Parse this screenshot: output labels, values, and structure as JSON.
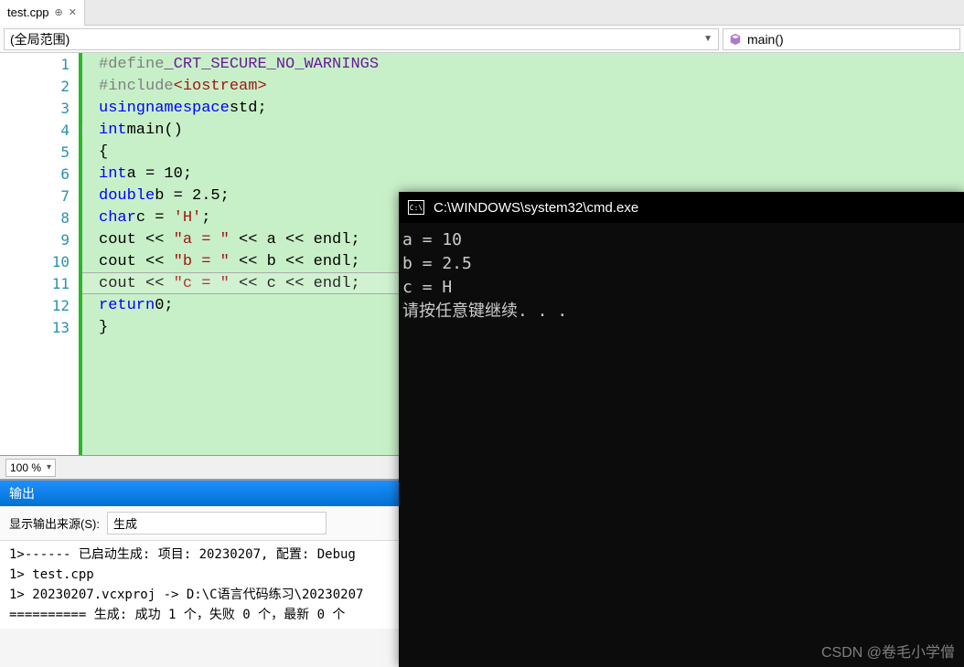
{
  "tab": {
    "filename": "test.cpp",
    "pin_icon": "📌",
    "close_icon": "✕"
  },
  "nav": {
    "scope": "(全局范围)",
    "function": "main()"
  },
  "code": {
    "lines": [
      {
        "n": 1,
        "html": "<span class='kw-define'>#define</span> <span class='kw-macro'>_CRT_SECURE_NO_WARNINGS</span>"
      },
      {
        "n": 2,
        "html": "<span class='kw-define'>#include</span><span class='kw-red'>&lt;iostream&gt;</span>"
      },
      {
        "n": 3,
        "html": "<span class='kw-blue'>using</span> <span class='kw-blue'>namespace</span> <span class='txt'>std;</span>"
      },
      {
        "n": 4,
        "html": "<span class='kw-blue'>int</span> <span class='txt'>main()</span>",
        "fold": true
      },
      {
        "n": 5,
        "html": "<span class='txt'>{</span>"
      },
      {
        "n": 6,
        "html": "    <span class='kw-blue'>int</span> <span class='txt'>a = 10;</span>"
      },
      {
        "n": 7,
        "html": "    <span class='kw-blue'>double</span> <span class='txt'>b = 2.5;</span>"
      },
      {
        "n": 8,
        "html": "    <span class='kw-blue'>char</span> <span class='txt'>c = </span><span class='str'>'H'</span><span class='txt'>;</span>"
      },
      {
        "n": 9,
        "html": "    <span class='txt'>cout &lt;&lt; </span><span class='str'>\"a = \"</span><span class='txt'> &lt;&lt; a &lt;&lt; endl;</span>"
      },
      {
        "n": 10,
        "html": "    <span class='txt'>cout &lt;&lt; </span><span class='str'>\"b = \"</span><span class='txt'> &lt;&lt; b &lt;&lt; endl;</span>"
      },
      {
        "n": 11,
        "html": "    <span class='txt'>cout &lt;&lt; </span><span class='str'>\"c = \"</span><span class='txt'> &lt;&lt; c &lt;&lt; endl;</span>"
      },
      {
        "n": 12,
        "html": "    <span class='kw-blue'>return</span> <span class='txt'>0;</span>"
      },
      {
        "n": 13,
        "html": "<span class='txt'>}</span>"
      }
    ]
  },
  "zoom": "100 %",
  "output": {
    "title": "输出",
    "source_label": "显示输出来源(S):",
    "source_value": "生成",
    "lines": [
      "1>------ 已启动生成:  项目: 20230207, 配置: Debug",
      "1>  test.cpp",
      "1>  20230207.vcxproj -> D:\\C语言代码练习\\20230207",
      "========== 生成:  成功 1 个，失败 0 个，最新 0 个"
    ]
  },
  "console": {
    "title": "C:\\WINDOWS\\system32\\cmd.exe",
    "lines": [
      "a = 10",
      "b = 2.5",
      "c = H",
      "请按任意键继续. . ."
    ]
  },
  "watermark": "CSDN @卷毛小学僧"
}
